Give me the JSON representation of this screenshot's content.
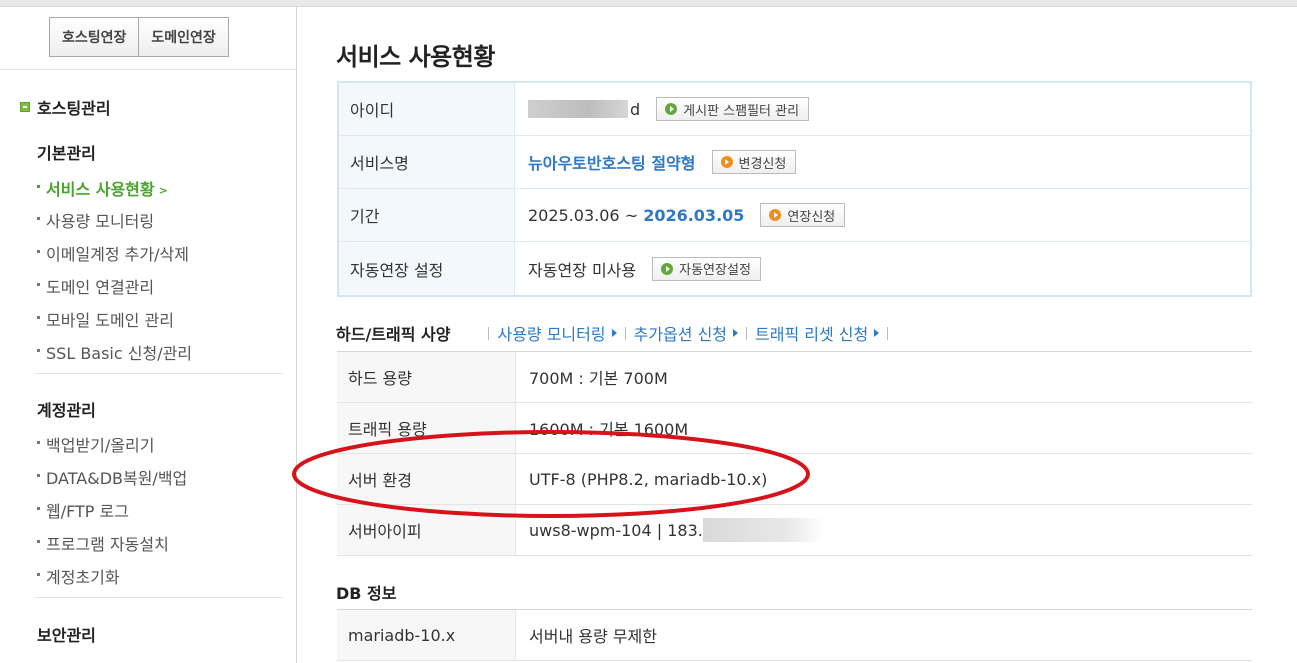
{
  "sidebar": {
    "ext_buttons": [
      "호스팅연장",
      "도메인연장"
    ],
    "section_title": "호스팅관리",
    "groups": [
      {
        "title": "기본관리",
        "items": [
          "서비스 사용현황",
          "사용량 모니터링",
          "이메일계정 추가/삭제",
          "도메인 연결관리",
          "모바일 도메인 관리",
          "SSL Basic 신청/관리"
        ]
      },
      {
        "title": "계정관리",
        "items": [
          "백업받기/올리기",
          "DATA&DB복원/백업",
          "웹/FTP 로그",
          "프로그램 자동설치",
          "계정초기화"
        ]
      },
      {
        "title": "보안관리",
        "items": []
      }
    ],
    "active_item": "서비스 사용현황"
  },
  "main": {
    "title": "서비스 사용현황",
    "info": {
      "id_label": "아이디",
      "id_suffix": "d",
      "id_button": "게시판 스팸필터 관리",
      "service_label": "서비스명",
      "service_value": "뉴아우토반호스팅 절약형",
      "service_button": "변경신청",
      "period_label": "기간",
      "period_start": "2025.03.06 ~ ",
      "period_end": "2026.03.05",
      "period_button": "연장신청",
      "auto_label": "자동연장 설정",
      "auto_value": "자동연장 미사용",
      "auto_button": "자동연장설정"
    },
    "spec_section": {
      "title": "하드/트래픽 사양",
      "links": [
        "사용량 모니터링",
        "추가옵션 신청",
        "트래픽 리셋 신청"
      ],
      "rows": [
        {
          "label": "하드 용량",
          "value": "700M : 기본 700M"
        },
        {
          "label": "트래픽 용량",
          "value": "1600M : 기본 1600M"
        },
        {
          "label": "서버 환경",
          "value": "UTF-8 (PHP8.2, mariadb-10.x)"
        },
        {
          "label": "서버아이피",
          "value": "uws8-wpm-104 | 183."
        }
      ]
    },
    "db_section": {
      "title": "DB 정보",
      "rows": [
        {
          "label": "mariadb-10.x",
          "value": "서버내 용량 무제한"
        }
      ]
    }
  },
  "annotation_color": "#d8121b"
}
